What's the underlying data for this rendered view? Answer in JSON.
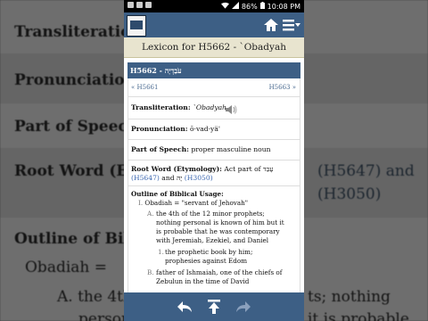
{
  "background": {
    "rows": [
      "Transliteration",
      "Pronunciation",
      "Part of Speech",
      "Root Word (Et",
      "Outline of Bibl",
      "Obadiah =",
      "A.  the 4th",
      "persor",
      "ts; nothing",
      "it is probable",
      "(H5647) and",
      "(H3050)"
    ]
  },
  "status": {
    "battery": "86%",
    "time": "10:08 PM"
  },
  "app": {
    "title": "Lexicon for H5662 - `Obadyah",
    "header": "H5662 - עֹבַדְיָה",
    "prev_link": "« H5661",
    "next_link": "H5663 »",
    "transliteration_label": "Transliteration:",
    "transliteration_value": "`Obadyah",
    "pronunciation_label": "Pronunciation:",
    "pronunciation_value": "ō·vad·yä'",
    "pos_label": "Part of Speech:",
    "pos_value": "proper masculine noun",
    "root_label": "Root Word (Etymology):",
    "root_text": "Act part of",
    "root_hebrew1": "עָבַד",
    "root_link1": "(H5647)",
    "root_and": "and",
    "root_hebrew2": "יָהּ",
    "root_link2": "(H3050)",
    "outline_label": "Outline of Biblical Usage:",
    "outline": {
      "item1_num": "I.",
      "item1_text": "Obadiah = \"servant of Jehovah\"",
      "a_num": "A.",
      "a_text": "the 4th of the 12 minor prophets; nothing personal is known of him but it is probable that he was contemporary with Jeremiah, Ezekiel, and Daniel",
      "a1_num": "1.",
      "a1_text": "the prophetic book by him; prophesies against Edom",
      "b_num": "B.",
      "b_text": "father of Ishmaiah, one of the chiefs of Zebulun in the time of David"
    }
  },
  "colors": {
    "primary": "#3d5f85",
    "title_bg": "#e8e4cf",
    "link": "#3a66b0"
  },
  "icons": {
    "speaker": "speaker-icon",
    "back": "back-arrow-icon",
    "top": "scroll-top-icon",
    "forward": "forward-arrow-icon"
  }
}
